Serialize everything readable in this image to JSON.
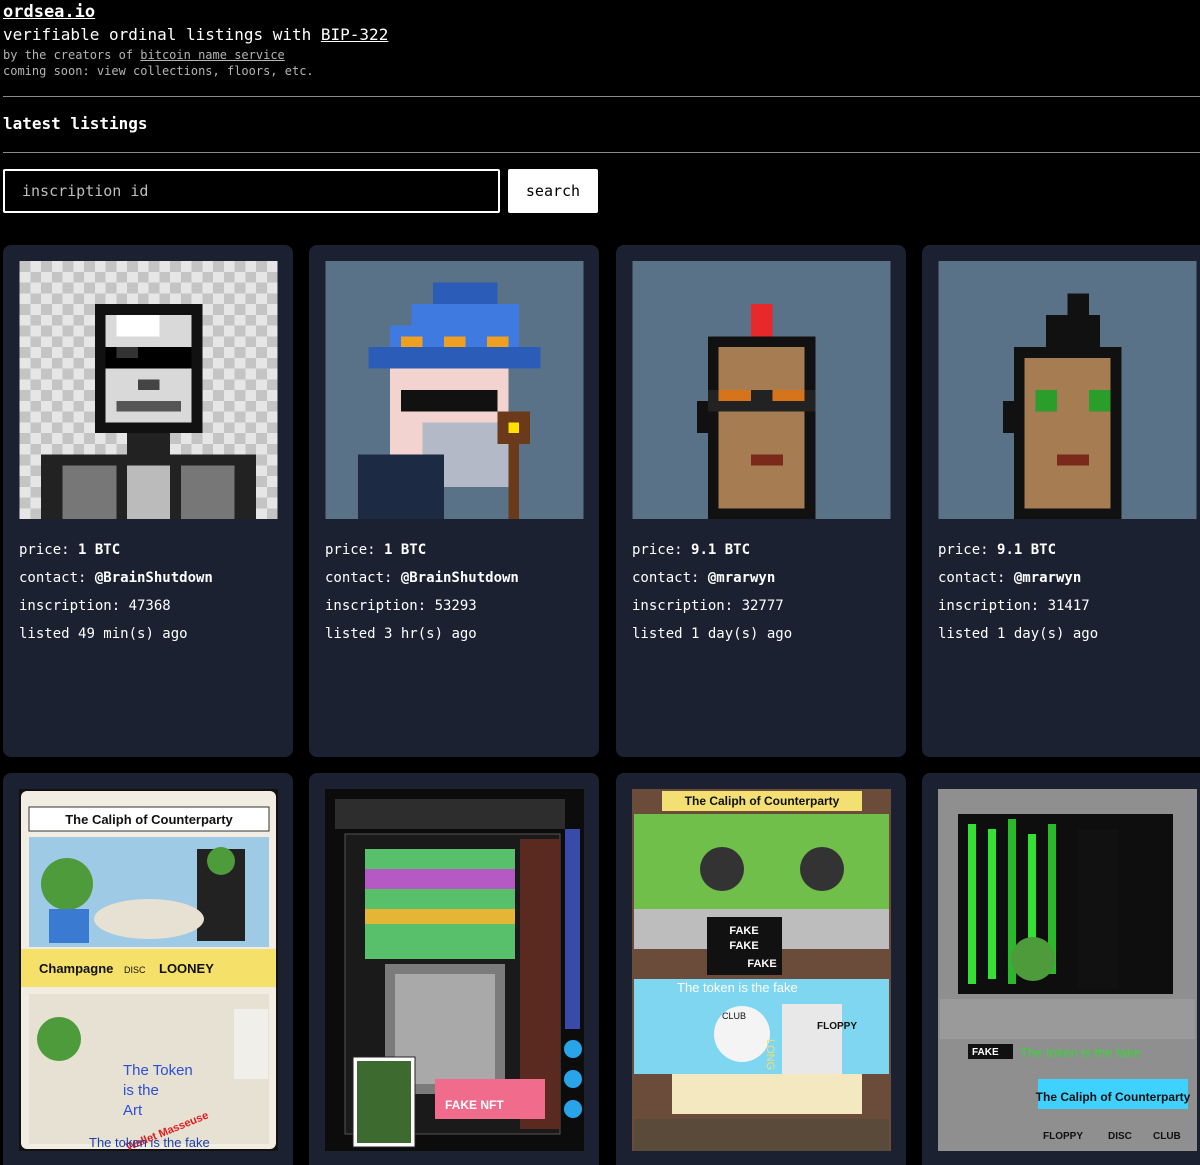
{
  "header": {
    "site_title": "ordsea.io",
    "tagline_prefix": "verifiable ordinal listings with ",
    "tagline_link": "BIP-322",
    "byline_prefix": "by the creators of ",
    "byline_link": "bitcoin name service",
    "coming_soon": "coming soon: view collections, floors, etc."
  },
  "section_title": "latest listings",
  "search": {
    "placeholder": "inscription id",
    "button_label": "search"
  },
  "labels": {
    "price": "price: ",
    "contact": "contact: ",
    "inscription": "inscription: ",
    "listed": "listed "
  },
  "listings": [
    {
      "price": "1 BTC",
      "contact": "@BrainShutdown",
      "inscription": "47368",
      "listed": "49 min(s) ago",
      "image": "skull-punk"
    },
    {
      "price": "1 BTC",
      "contact": "@BrainShutdown",
      "inscription": "53293",
      "listed": "3 hr(s) ago",
      "image": "wizard-punk"
    },
    {
      "price": "9.1 BTC",
      "contact": "@mrarwyn",
      "inscription": "32777",
      "listed": "1 day(s) ago",
      "image": "mohawk-punk-red"
    },
    {
      "price": "9.1 BTC",
      "contact": "@mrarwyn",
      "inscription": "31417",
      "listed": "1 day(s) ago",
      "image": "mohawk-punk-black"
    },
    {
      "image": "caliph-card",
      "texts": [
        "The Caliph of Counterparty",
        "Champagne",
        "DISC",
        "LOONEY",
        "The Token",
        "is the",
        "Art",
        "Wallet Masseuse",
        "The token is the fake"
      ]
    },
    {
      "image": "glitch-collage",
      "texts": [
        "FAKE NFT"
      ]
    },
    {
      "image": "caliph-collage",
      "texts": [
        "The Caliph of Counterparty",
        "FAKE",
        "FAKE",
        "FAKE",
        "The token is the fake",
        "CLUB",
        "FLOPPY",
        "LONG"
      ]
    },
    {
      "image": "matrix-collage",
      "texts": [
        "FAKE",
        "The token is the fake",
        "The Caliph of Counterparty",
        "FLOPPY",
        "DISC",
        "CLUB"
      ]
    }
  ]
}
